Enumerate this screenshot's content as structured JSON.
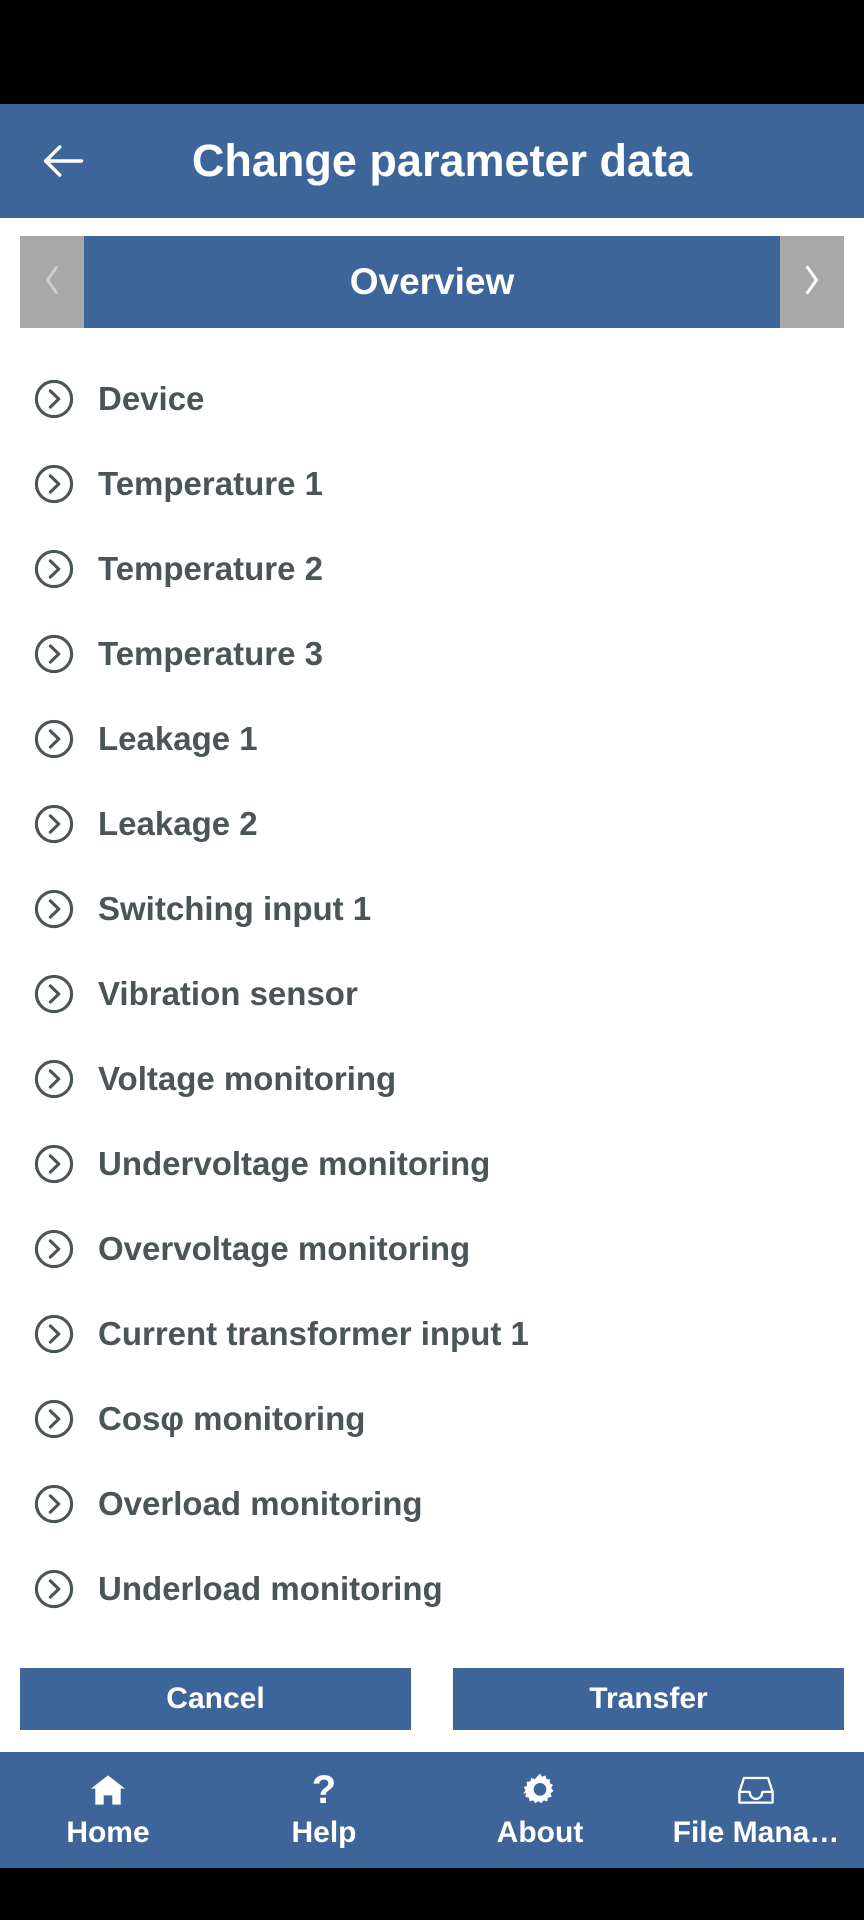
{
  "statusbar": {
    "present": true
  },
  "appbar": {
    "back_icon": "arrow-left-icon",
    "title": "Change parameter data",
    "background": "#3e6599",
    "text_color": "#ffffff"
  },
  "pager": {
    "prev_icon": "chevron-left-icon",
    "next_icon": "chevron-right-icon",
    "title": "Overview",
    "arrow_background": "#a8a8a8",
    "title_background": "#3e6599"
  },
  "list": {
    "chevron_icon": "chevron-right-circle-icon",
    "label_color": "#4b5457",
    "items": [
      {
        "label": "Device"
      },
      {
        "label": "Temperature 1"
      },
      {
        "label": "Temperature 2"
      },
      {
        "label": "Temperature 3"
      },
      {
        "label": "Leakage 1"
      },
      {
        "label": "Leakage 2"
      },
      {
        "label": "Switching input 1"
      },
      {
        "label": "Vibration sensor"
      },
      {
        "label": "Voltage monitoring"
      },
      {
        "label": "Undervoltage monitoring"
      },
      {
        "label": "Overvoltage monitoring"
      },
      {
        "label": "Current transformer input 1"
      },
      {
        "label": "Cosφ monitoring"
      },
      {
        "label": "Overload monitoring"
      },
      {
        "label": "Underload monitoring"
      }
    ]
  },
  "actions": {
    "cancel_label": "Cancel",
    "transfer_label": "Transfer",
    "background": "#3e6599"
  },
  "bottomnav": {
    "background": "#3e6599",
    "items": [
      {
        "label": "Home",
        "icon": "home-icon"
      },
      {
        "label": "Help",
        "icon": "question-mark-icon"
      },
      {
        "label": "About",
        "icon": "gear-icon"
      },
      {
        "label": "File Mana…",
        "icon": "inbox-tray-icon"
      }
    ]
  }
}
